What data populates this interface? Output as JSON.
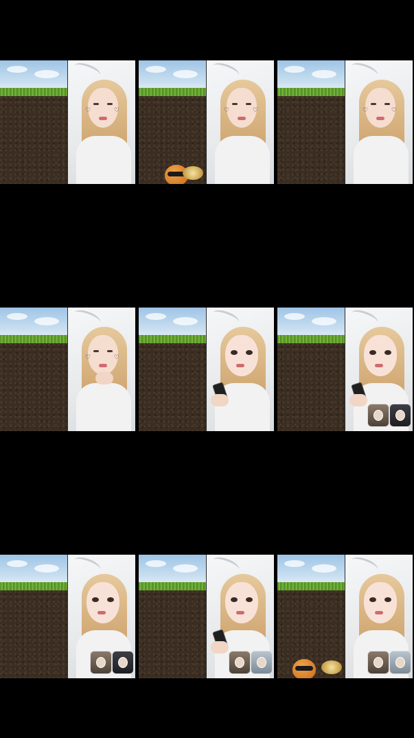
{
  "grid": {
    "frames": [
      {
        "id": "frame-1",
        "row": 1,
        "col": 1,
        "filter": "stickers",
        "thumbnails": [],
        "extra": "none"
      },
      {
        "id": "frame-2",
        "row": 1,
        "col": 2,
        "filter": "stickers",
        "thumbnails": [],
        "extra": "mascot"
      },
      {
        "id": "frame-3",
        "row": 1,
        "col": 3,
        "filter": "stickers",
        "thumbnails": [],
        "extra": "none"
      },
      {
        "id": "frame-4",
        "row": 2,
        "col": 1,
        "filter": "stickers",
        "thumbnails": [],
        "extra": "hand-on-chin"
      },
      {
        "id": "frame-5",
        "row": 2,
        "col": 2,
        "filter": "cartoon",
        "thumbnails": [],
        "extra": "phone"
      },
      {
        "id": "frame-6",
        "row": 2,
        "col": 3,
        "filter": "cartoon",
        "thumbnails": [
          "avatar",
          "dark"
        ],
        "extra": "phone"
      },
      {
        "id": "frame-7",
        "row": 3,
        "col": 1,
        "filter": "cartoon",
        "thumbnails": [
          "avatar",
          "dark"
        ],
        "extra": "none"
      },
      {
        "id": "frame-8",
        "row": 3,
        "col": 2,
        "filter": "cartoon",
        "thumbnails": [
          "avatar",
          "man"
        ],
        "extra": "phone"
      },
      {
        "id": "frame-9",
        "row": 3,
        "col": 3,
        "filter": "cartoon",
        "thumbnails": [
          "avatar",
          "man"
        ],
        "extra": "mascot"
      }
    ]
  },
  "colors": {
    "background": "#000000",
    "sky": "#9fc4e6",
    "grass": "#5e9a2c",
    "soil": "#3a2d22",
    "hair": "#cfa671"
  },
  "icons": [
    "sticker-heart-icon",
    "mascot-icon",
    "cymbal-icon",
    "thumbnail-avatar-icon"
  ]
}
